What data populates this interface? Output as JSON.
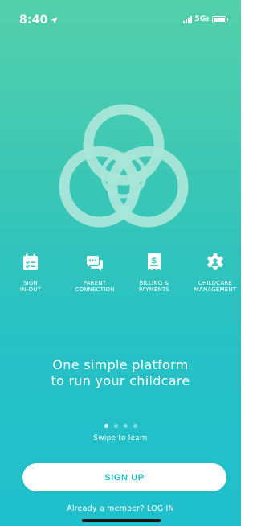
{
  "status_bar": {
    "time": "8:40",
    "network": "5G",
    "network_suffix": "E",
    "location_icon": "location-arrow-icon",
    "signal_icon": "cellular-signal-icon",
    "battery_icon": "battery-icon"
  },
  "logo": {
    "icon": "interlocking-rings-logo"
  },
  "features": [
    {
      "icon": "sign-in-out-icon",
      "line1": "SIGN",
      "line2": "IN-OUT"
    },
    {
      "icon": "chat-bubbles-icon",
      "line1": "PARENT",
      "line2": "CONNECTION"
    },
    {
      "icon": "invoice-dollar-icon",
      "line1": "BILLING &",
      "line2": "PAYMENTS"
    },
    {
      "icon": "gear-person-icon",
      "line1": "CHILDCARE",
      "line2": "MANAGEMENT"
    }
  ],
  "tagline": {
    "line1": "One simple platform",
    "line2": "to run your childcare"
  },
  "pager": {
    "total": 4,
    "active_index": 0
  },
  "swipe_hint": "Swipe to learn",
  "signup_label": "SIGN UP",
  "login_text": "Already a member? LOG IN",
  "colors": {
    "background_top": "#54cfa9",
    "background_bottom": "#1fbfcd",
    "logo_fill": "#a9e6d9",
    "button_text": "#22bcc7",
    "white": "#ffffff"
  }
}
